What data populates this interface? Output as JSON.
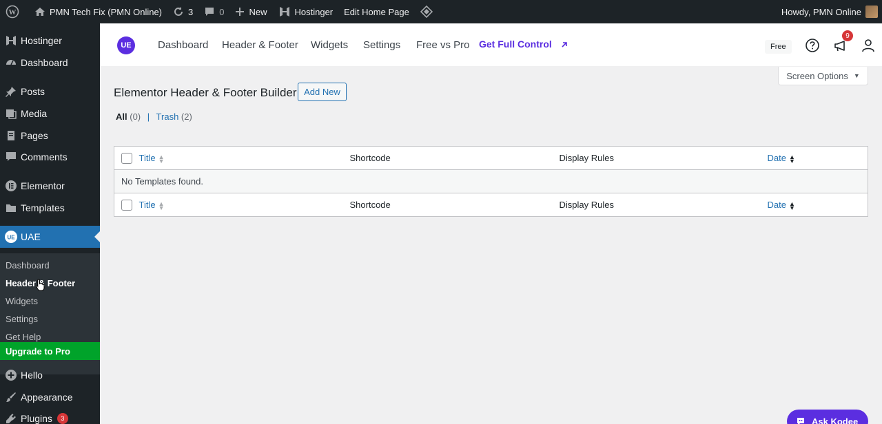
{
  "adminbar": {
    "site_name": "PMN Tech Fix (PMN Online)",
    "updates_count": "3",
    "comments_count": "0",
    "new_label": "New",
    "hostinger_label": "Hostinger",
    "edit_page_label": "Edit Home Page",
    "howdy": "Howdy, PMN Online"
  },
  "sidebar": {
    "items": [
      {
        "label": "Hostinger",
        "icon": "hostinger-icon"
      },
      {
        "label": "Dashboard",
        "icon": "dashboard-icon"
      },
      {
        "label": "Posts",
        "icon": "pin-icon"
      },
      {
        "label": "Media",
        "icon": "media-icon"
      },
      {
        "label": "Pages",
        "icon": "page-icon"
      },
      {
        "label": "Comments",
        "icon": "comment-icon"
      },
      {
        "label": "Elementor",
        "icon": "elementor-icon"
      },
      {
        "label": "Templates",
        "icon": "folder-icon"
      },
      {
        "label": "UAE",
        "icon": "uae-icon"
      },
      {
        "label": "Hello",
        "icon": "plus-circle-icon"
      },
      {
        "label": "Appearance",
        "icon": "brush-icon"
      },
      {
        "label": "Plugins",
        "icon": "plug-icon",
        "badge": "3"
      }
    ],
    "submenu": [
      "Dashboard",
      "Header & Footer",
      "Widgets",
      "Settings",
      "Get Help"
    ],
    "upgrade": "Upgrade to Pro"
  },
  "uae_nav": {
    "logo": "UE",
    "tabs": [
      "Dashboard",
      "Header & Footer",
      "Widgets",
      "Settings",
      "Free vs Pro"
    ],
    "pro_link": "Get Full Control",
    "free_badge": "Free",
    "notifications": "9"
  },
  "screen_options": "Screen Options",
  "page": {
    "title": "Elementor Header & Footer Builder",
    "add_new": "Add New",
    "filter_all": "All",
    "filter_all_count": "(0)",
    "separator": "|",
    "filter_trash": "Trash",
    "filter_trash_count": "(2)"
  },
  "table": {
    "columns": [
      "Title",
      "Shortcode",
      "Display Rules",
      "Date"
    ],
    "empty_message": "No Templates found."
  },
  "ask_button": "Ask Kodee",
  "colors": {
    "admin_dark": "#1d2327",
    "wp_blue": "#2271b1",
    "uae_purple": "#5b2ee0",
    "upgrade_green": "#00a32a",
    "badge_red": "#d63638"
  }
}
